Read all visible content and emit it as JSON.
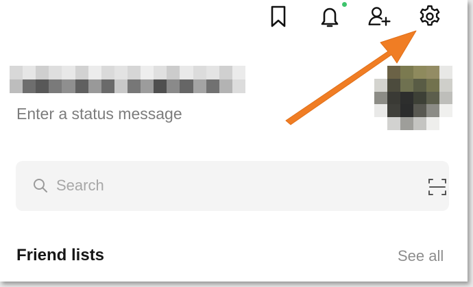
{
  "topbar": {
    "icons": [
      "bookmark-icon",
      "bell-icon",
      "add-friend-icon",
      "settings-gear-icon"
    ],
    "notification_dot_color": "#3ec46d"
  },
  "profile": {
    "status_message_placeholder": "Enter a status message"
  },
  "search": {
    "placeholder": "Search",
    "icons": [
      "search-icon",
      "scan-icon"
    ]
  },
  "friends": {
    "title": "Friend lists",
    "see_all_label": "See all"
  },
  "annotation": {
    "arrow_color": "#f07d24",
    "points_to": "settings-gear-icon"
  }
}
